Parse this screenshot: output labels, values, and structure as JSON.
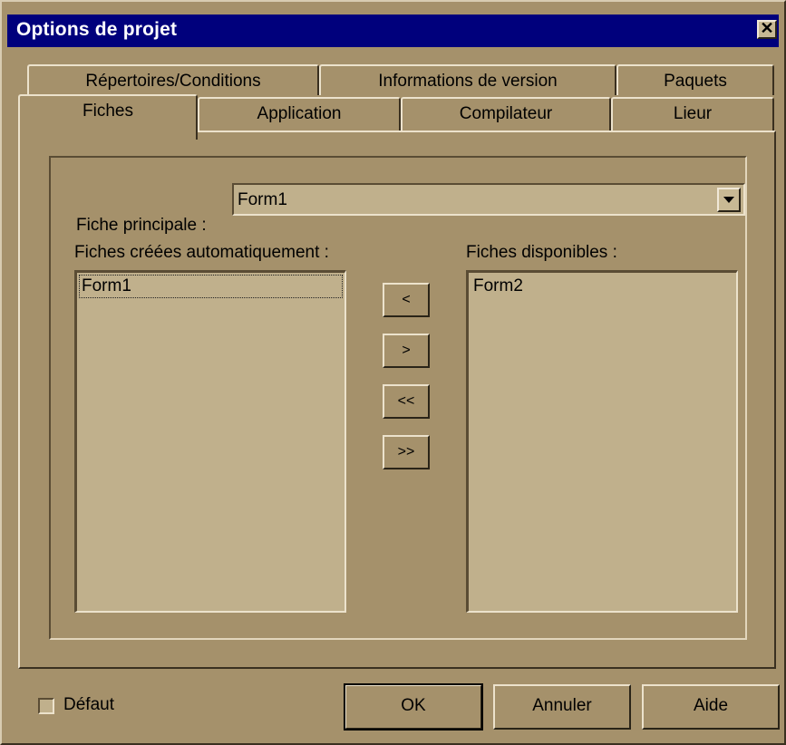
{
  "window": {
    "title": "Options de projet",
    "close_glyph": "✕"
  },
  "tabs": {
    "back_row": [
      "Répertoires/Conditions",
      "Informations de version",
      "Paquets"
    ],
    "front_row": [
      "Fiches",
      "Application",
      "Compilateur",
      "Lieur"
    ],
    "active": "Fiches"
  },
  "main_form": {
    "label": "Fiche principale :",
    "value": "Form1"
  },
  "auto_forms": {
    "label": "Fiches créées automatiquement :",
    "items": [
      "Form1"
    ]
  },
  "available_forms": {
    "label": "Fiches disponibles :",
    "items": [
      "Form2"
    ]
  },
  "move_buttons": [
    "<",
    ">",
    "<<",
    ">>"
  ],
  "default_checkbox": {
    "label": "Défaut",
    "checked": false
  },
  "buttons": {
    "ok": "OK",
    "cancel": "Annuler",
    "help": "Aide"
  },
  "colors": {
    "face": "#a5916b",
    "titlebar": "#00007c",
    "list_bg": "#c0b08c"
  }
}
